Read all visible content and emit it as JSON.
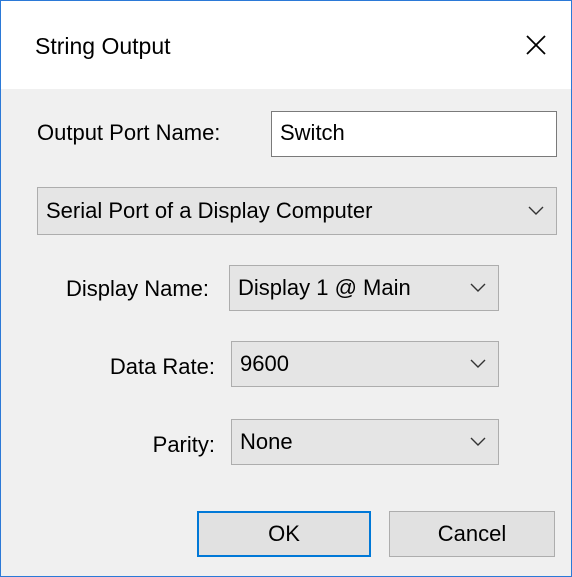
{
  "window": {
    "title": "String Output",
    "close_icon": "close-icon"
  },
  "form": {
    "output_port_name_label": "Output Port Name:",
    "output_port_name_value": "Switch",
    "port_type_value": "Serial Port of a Display Computer",
    "display_name_label": "Display Name:",
    "display_name_value": "Display 1 @ Main",
    "data_rate_label": "Data Rate:",
    "data_rate_value": "9600",
    "parity_label": "Parity:",
    "parity_value": "None"
  },
  "buttons": {
    "ok_label": "OK",
    "cancel_label": "Cancel"
  },
  "colors": {
    "window_border": "#2b79d7",
    "client_background": "#f0f0f0",
    "default_button_border": "#0078d7"
  }
}
